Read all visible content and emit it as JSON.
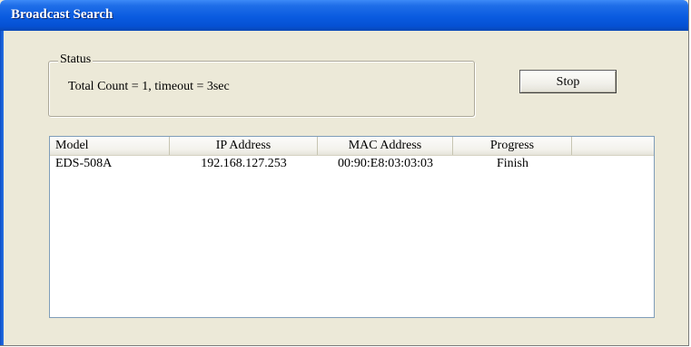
{
  "window": {
    "title": "Broadcast Search"
  },
  "status": {
    "group_label": "Status",
    "text": "Total Count = 1, timeout = 3sec"
  },
  "buttons": {
    "stop_label": "Stop"
  },
  "table": {
    "columns": [
      "Model",
      "IP Address",
      "MAC Address",
      "Progress"
    ],
    "rows": [
      {
        "model": "EDS-508A",
        "ip": "192.168.127.253",
        "mac": "00:90:E8:03:03:03",
        "progress": "Finish"
      }
    ]
  },
  "colors": {
    "titlebar": "#0a5be0",
    "window_bg": "#ece9d8",
    "list_bg": "#ffffff"
  }
}
